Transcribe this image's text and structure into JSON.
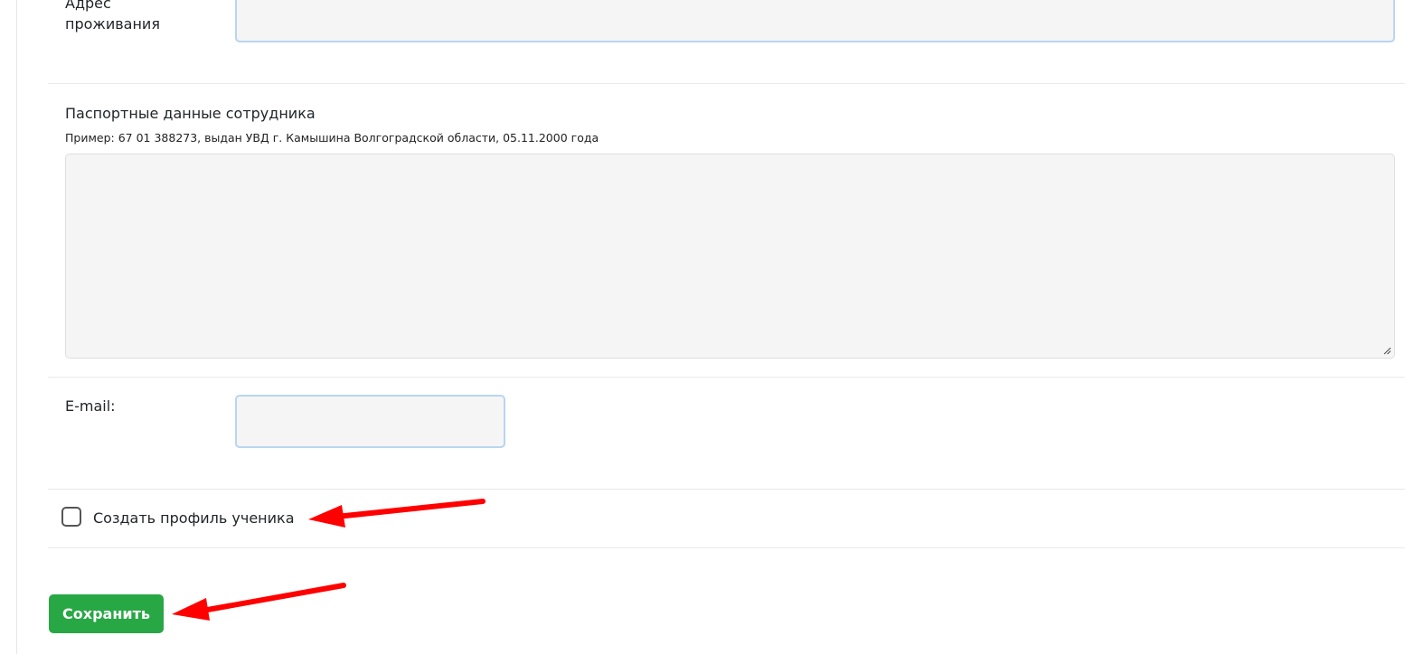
{
  "form": {
    "address_label": "Адрес\nпроживания",
    "passport_label": "Паспортные данные сотрудника",
    "passport_hint": "Пример: 67 01 388273, выдан УВД г. Камышина Волгоградской области, 05.11.2000 года",
    "passport_value": "",
    "email_label": "E-mail:",
    "email_value": "",
    "create_profile_label": "Создать профиль ученика",
    "create_profile_checked": false,
    "save_label": "Сохранить"
  },
  "colors": {
    "save_button": "#28a745",
    "annotation_arrow": "#ff0000",
    "focus_border": "#b9d5f0",
    "field_background": "#f5f5f5"
  }
}
